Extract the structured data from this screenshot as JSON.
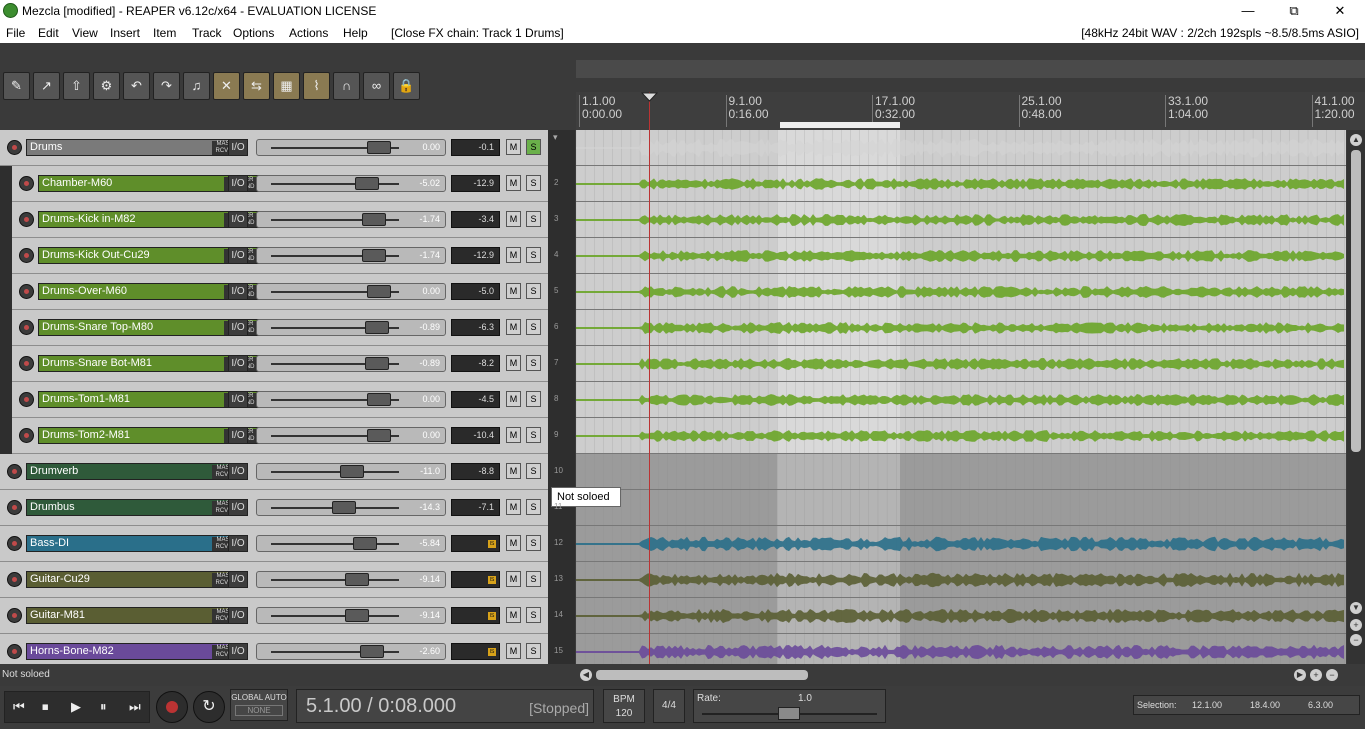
{
  "window": {
    "title": "Mezcla [modified] - REAPER v6.12c/x64 - EVALUATION LICENSE",
    "minimize": "—",
    "maximize": "⧉",
    "close": "✕"
  },
  "menu": {
    "items": [
      "File",
      "Edit",
      "View",
      "Insert",
      "Item",
      "Track",
      "Options",
      "Actions",
      "Help"
    ],
    "fx_status": "[Close FX chain: Track 1 Drums]",
    "audio_status": "[48kHz 24bit WAV : 2/2ch 192spls ~8.5/8.5ms ASIO]"
  },
  "toolbar": {
    "icons": [
      "new-project-icon",
      "open-project-icon",
      "save-project-icon",
      "project-settings-icon",
      "undo-icon",
      "redo-icon",
      "metronome-icon",
      "auto-crossfade-icon",
      "ripple-edit-icon",
      "grid-icon",
      "envelope-icon",
      "snap-icon",
      "loop-icon",
      "lock-icon"
    ],
    "active": [
      7,
      8,
      9,
      10
    ]
  },
  "ruler": {
    "marks": [
      {
        "bar": "1.1.00",
        "time": "0:00.00"
      },
      {
        "bar": "9.1.00",
        "time": "0:16.00"
      },
      {
        "bar": "17.1.00",
        "time": "0:32.00"
      },
      {
        "bar": "25.1.00",
        "time": "0:48.00"
      },
      {
        "bar": "33.1.00",
        "time": "1:04.00"
      },
      {
        "bar": "41.1.00",
        "time": "1:20.00"
      }
    ]
  },
  "tracks": [
    {
      "name": "Drums",
      "num": "",
      "folder": true,
      "color": "#7a7a7a",
      "volume": "0.00",
      "peak": "-0.1",
      "solo": true,
      "clip": false,
      "wave": "#d3d3d3"
    },
    {
      "name": "Chamber-M60",
      "num": "2",
      "folder": false,
      "color": "#5f8e2a",
      "volume": "-5.02",
      "peak": "-12.9",
      "solo": false,
      "clip": false,
      "wave": "#6aa528"
    },
    {
      "name": "Drums-Kick in-M82",
      "num": "3",
      "folder": false,
      "color": "#5f8e2a",
      "volume": "-1.74",
      "peak": "-3.4",
      "solo": false,
      "clip": false,
      "wave": "#6aa528"
    },
    {
      "name": "Drums-Kick Out-Cu29",
      "num": "4",
      "folder": false,
      "color": "#5f8e2a",
      "volume": "-1.74",
      "peak": "-12.9",
      "solo": false,
      "clip": false,
      "wave": "#6aa528"
    },
    {
      "name": "Drums-Over-M60",
      "num": "5",
      "folder": false,
      "color": "#5f8e2a",
      "volume": "0.00",
      "peak": "-5.0",
      "solo": false,
      "clip": false,
      "wave": "#6aa528"
    },
    {
      "name": "Drums-Snare Top-M80",
      "num": "6",
      "folder": false,
      "color": "#5f8e2a",
      "volume": "-0.89",
      "peak": "-6.3",
      "solo": false,
      "clip": false,
      "wave": "#6aa528"
    },
    {
      "name": "Drums-Snare Bot-M81",
      "num": "7",
      "folder": false,
      "color": "#5f8e2a",
      "volume": "-0.89",
      "peak": "-8.2",
      "solo": false,
      "clip": false,
      "wave": "#6aa528"
    },
    {
      "name": "Drums-Tom1-M81",
      "num": "8",
      "folder": false,
      "color": "#5f8e2a",
      "volume": "0.00",
      "peak": "-4.5",
      "solo": false,
      "clip": false,
      "wave": "#6aa528"
    },
    {
      "name": "Drums-Tom2-M81",
      "num": "9",
      "folder": false,
      "color": "#5f8e2a",
      "volume": "0.00",
      "peak": "-10.4",
      "solo": false,
      "clip": false,
      "wave": "#6aa528"
    },
    {
      "name": "Drumverb",
      "num": "10",
      "folder": false,
      "color": "#2f5a3a",
      "volume": "-11.0",
      "peak": "-8.8",
      "solo": false,
      "clip": false,
      "wave": ""
    },
    {
      "name": "Drumbus",
      "num": "11",
      "folder": false,
      "color": "#2f5a3a",
      "volume": "-14.3",
      "peak": "-7.1",
      "solo": false,
      "clip": false,
      "wave": ""
    },
    {
      "name": "Bass-DI",
      "num": "12",
      "folder": false,
      "color": "#2a6f8a",
      "volume": "-5.84",
      "peak": "",
      "solo": false,
      "clip": true,
      "wave": "#2a6f8a"
    },
    {
      "name": "Guitar-Cu29",
      "num": "13",
      "folder": false,
      "color": "#5a5e33",
      "volume": "-9.14",
      "peak": "",
      "solo": false,
      "clip": true,
      "wave": "#5a5e33"
    },
    {
      "name": "Guitar-M81",
      "num": "14",
      "folder": false,
      "color": "#5a5e33",
      "volume": "-9.14",
      "peak": "",
      "solo": false,
      "clip": true,
      "wave": "#5a5e33"
    },
    {
      "name": "Horns-Bone-M82",
      "num": "15",
      "folder": false,
      "color": "#6a4a9a",
      "volume": "-2.60",
      "peak": "",
      "solo": false,
      "clip": true,
      "wave": "#6a4a9a"
    }
  ],
  "tcp": {
    "routing_top": "MASTER",
    "routing_bottom": "RCV SND",
    "io_label": "I/O",
    "mute_label": "M",
    "solo_label": "S",
    "clip_label": "IS"
  },
  "tooltip": "Not soloed",
  "status": "Not soloed",
  "transport": {
    "global_auto_label": "GLOBAL AUTO",
    "global_auto_value": "NONE",
    "position": "5.1.00 / 0:08.000",
    "state": "[Stopped]",
    "bpm_label": "BPM",
    "bpm_value": "120",
    "time_sig": "4/4",
    "rate_label": "Rate:",
    "rate_value": "1.0",
    "selection_label": "Selection:",
    "selection_start": "12.1.00",
    "selection_end": "18.4.00",
    "selection_length": "6.3.00"
  }
}
